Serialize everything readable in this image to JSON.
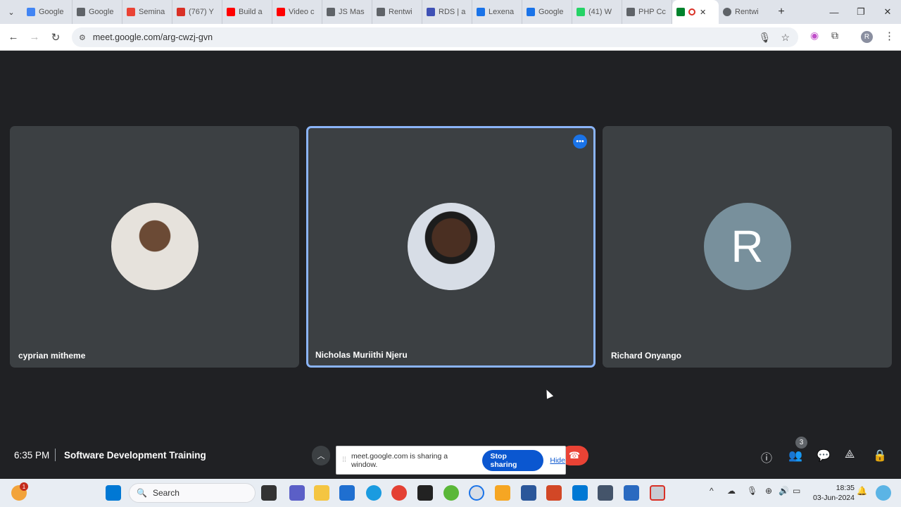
{
  "browser": {
    "tabs": [
      {
        "label": "Google",
        "color": "#4285f4"
      },
      {
        "label": "Google",
        "color": "#5f6368"
      },
      {
        "label": "Semina",
        "color": "#ea4335"
      },
      {
        "label": "(767) Y",
        "color": "#d93025"
      },
      {
        "label": "Build a",
        "color": "#ff0000"
      },
      {
        "label": "Video c",
        "color": "#ff0000"
      },
      {
        "label": "JS Mas",
        "color": "#5f6368"
      },
      {
        "label": "Rentwi",
        "color": "#5f6368"
      },
      {
        "label": "RDS | a",
        "color": "#3f51b5"
      },
      {
        "label": "Lexena",
        "color": "#1a73e8"
      },
      {
        "label": "Google",
        "color": "#1a73e8"
      },
      {
        "label": "(41) W",
        "color": "#25d366"
      },
      {
        "label": "PHP Cc",
        "color": "#5f6368"
      }
    ],
    "active_tab": {
      "label": "Google Meet",
      "icon": "meet-icon"
    },
    "last_tab": {
      "label": "Rentwi"
    },
    "url": "meet.google.com/arg-cwzj-gvn",
    "profile_initial": "R"
  },
  "meeting": {
    "time": "6:35 PM",
    "title": "Software Development Training",
    "participant_count": "3",
    "participants": [
      {
        "name": "cyprian mitheme",
        "avatar": "photo"
      },
      {
        "name": "Nicholas Muriithi Njeru",
        "avatar": "photo",
        "speaking": true
      },
      {
        "name": "Richard Onyango",
        "avatar_letter": "R"
      }
    ]
  },
  "share_bar": {
    "message": "meet.google.com is sharing a window.",
    "stop_label": "Stop sharing",
    "hide_label": "Hide"
  },
  "taskbar": {
    "search_label": "Search",
    "notification_count": "1",
    "clock_time": "18:35",
    "clock_date": "03-Jun-2024"
  }
}
